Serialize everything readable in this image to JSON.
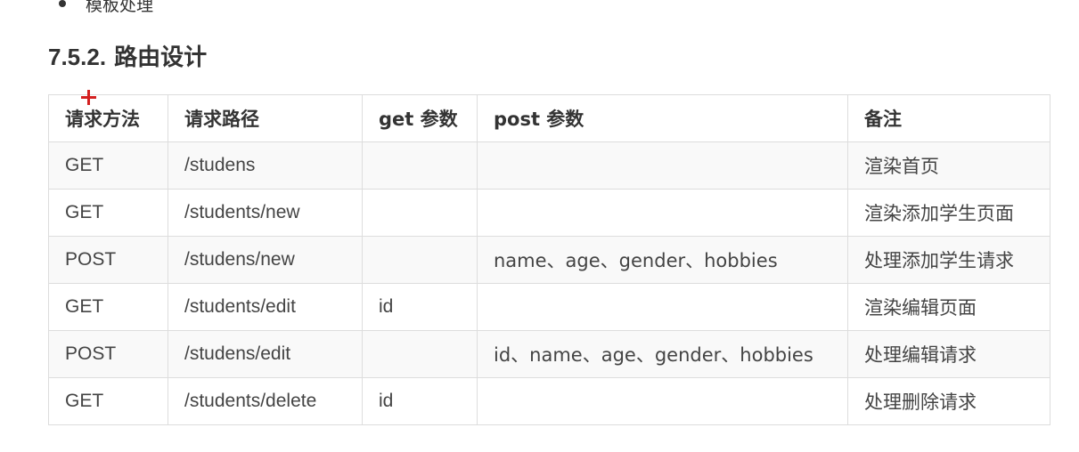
{
  "bullet": {
    "text": "模板处理"
  },
  "section": {
    "number": "7.5.2.",
    "title": "路由设计"
  },
  "table": {
    "headers": [
      "请求方法",
      "请求路径",
      "get 参数",
      "post 参数",
      "备注"
    ],
    "rows": [
      [
        "GET",
        "/studens",
        "",
        "",
        "渲染首页"
      ],
      [
        "GET",
        "/students/new",
        "",
        "",
        "渲染添加学生页面"
      ],
      [
        "POST",
        "/studens/new",
        "",
        "name、age、gender、hobbies",
        "处理添加学生请求"
      ],
      [
        "GET",
        "/students/edit",
        "id",
        "",
        "渲染编辑页面"
      ],
      [
        "POST",
        "/studens/edit",
        "",
        "id、name、age、gender、hobbies",
        "处理编辑请求"
      ],
      [
        "GET",
        "/students/delete",
        "id",
        "",
        "处理删除请求"
      ]
    ]
  },
  "colors": {
    "text": "#333333",
    "border": "#dddddd",
    "stripe": "#f9f9f9",
    "cursor": "#d42020"
  }
}
